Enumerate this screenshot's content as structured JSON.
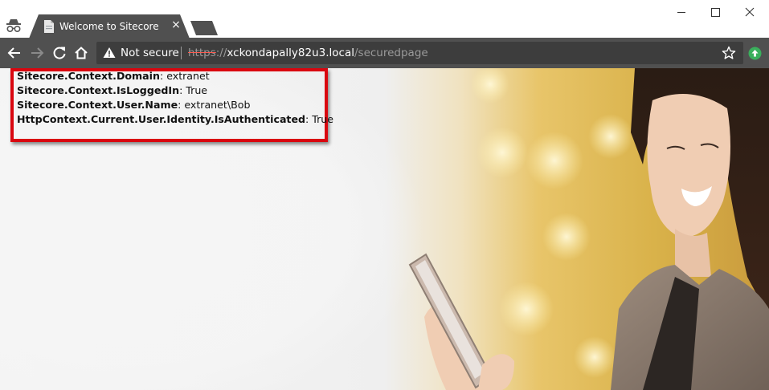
{
  "browser": {
    "tab": {
      "title": "Welcome to Sitecore",
      "close_glyph": "×"
    },
    "window_controls": {
      "minimize": "minimize-icon",
      "maximize": "maximize-icon",
      "close": "close-icon"
    }
  },
  "toolbar": {
    "security_label": "Not secure",
    "url": {
      "scheme": "https",
      "separator": "://",
      "host": "xckondapally82u3.local",
      "path": "/securedpage"
    }
  },
  "page": {
    "info": [
      {
        "key": "Sitecore.Context.Domain",
        "value": ": extranet"
      },
      {
        "key": "Sitecore.Context.IsLoggedIn",
        "value": ": True"
      },
      {
        "key": "Sitecore.Context.User.Name",
        "value": ": extranet\\Bob"
      },
      {
        "key": "HttpContext.Current.User.Identity.IsAuthenticated",
        "value": ": True"
      }
    ]
  },
  "colors": {
    "toolbar": "#505050",
    "omnibox": "#3d3d3d",
    "highlight_border": "#d9060f",
    "extension_green": "#3aaf5c"
  }
}
